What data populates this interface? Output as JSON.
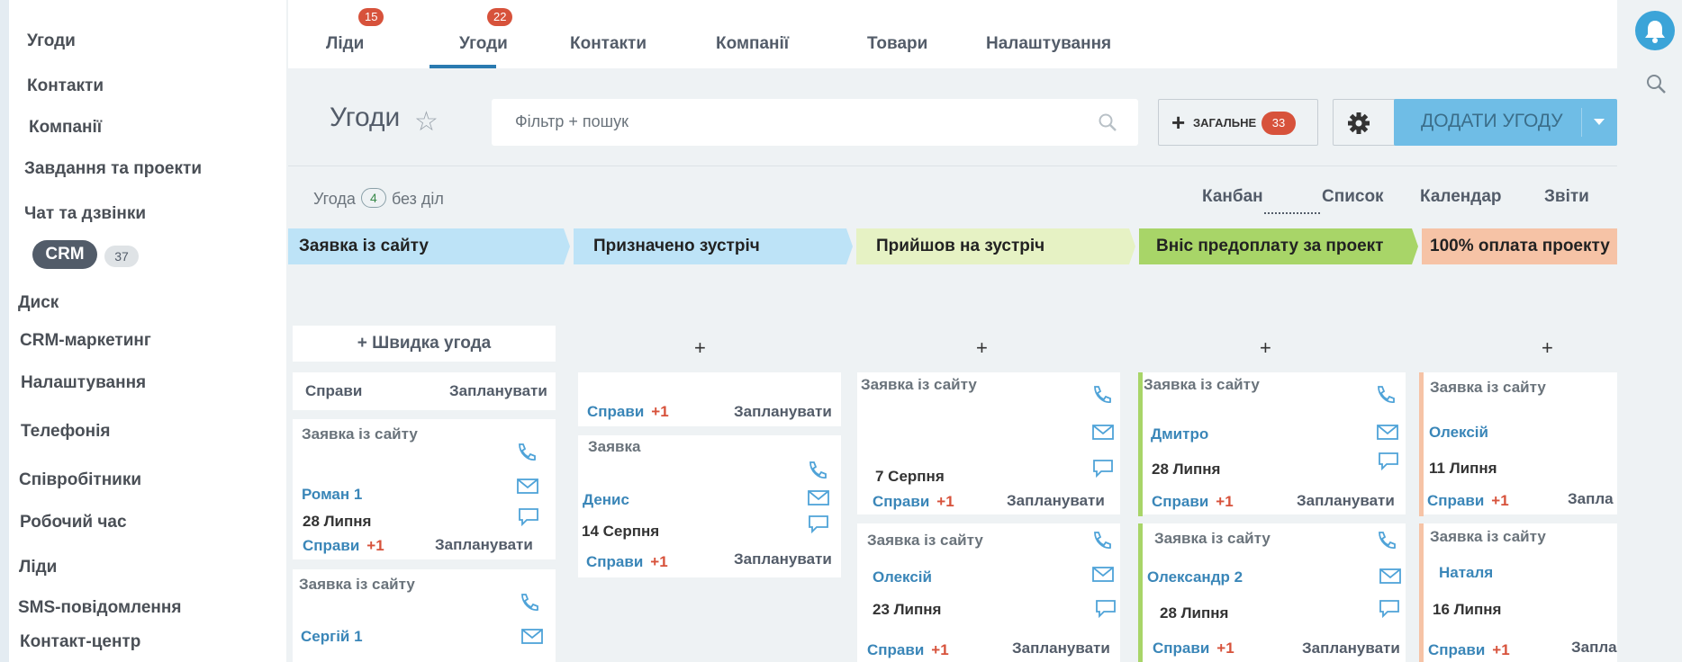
{
  "sidebar": {
    "items": [
      {
        "label": "Угоди"
      },
      {
        "label": "Контакти"
      },
      {
        "label": "Компанії"
      },
      {
        "label": "Завдання та проекти"
      },
      {
        "label": "Чат та дзвінки"
      },
      {
        "label": "Диск"
      },
      {
        "label": "CRM-маркетинг"
      },
      {
        "label": "Налаштування"
      },
      {
        "label": "Телефонія"
      },
      {
        "label": "Співробітники"
      },
      {
        "label": "Робочий час"
      },
      {
        "label": "Ліди"
      },
      {
        "label": "SMS-повідомлення"
      },
      {
        "label": "Контакт-центр"
      }
    ],
    "crm": {
      "label": "CRM",
      "count": "37"
    }
  },
  "tabs": [
    {
      "label": "Ліди",
      "badge": "15"
    },
    {
      "label": "Угоди",
      "badge": "22"
    },
    {
      "label": "Контакти"
    },
    {
      "label": "Компанії"
    },
    {
      "label": "Товари"
    },
    {
      "label": "Налаштування"
    }
  ],
  "header": {
    "title": "Угоди",
    "search_placeholder": "Фільтр + пошук",
    "general_label": "ЗАГАЛЬНЕ",
    "general_badge": "33",
    "add_label": "ДОДАТИ УГОДУ"
  },
  "summary": {
    "prefix": "Угода",
    "count": "4",
    "suffix": "без  діл"
  },
  "views": [
    "Канбан",
    "Список",
    "Календар",
    "Звіти"
  ],
  "quick_deal": "+ Швидка угода",
  "colors": {
    "accent": "#3a86b8",
    "badge": "#d7523b",
    "add_button": "#6fbde6"
  },
  "stages": [
    {
      "name": "Заявка із сайту",
      "color": "#bde3f7"
    },
    {
      "name": "Призначено зустріч",
      "color": "#bde3f7"
    },
    {
      "name": "Прийшов на  зустріч",
      "color": "#e6f2c4"
    },
    {
      "name": "Вніс предоплату за проект",
      "color": "#a8d568"
    },
    {
      "name": "100% оплата проекту",
      "color": "#f6c3a6"
    }
  ],
  "common": {
    "deals": "Справи",
    "plus": "+1",
    "plan": "Запланувати",
    "plus_add": "+"
  },
  "cards": [
    {
      "title": "Заявка із сайту",
      "name": "Роман 1",
      "date": "28 Липня"
    },
    {
      "title": "Заявка із сайту",
      "name": "Сергій 1"
    },
    {
      "title": "Заявка",
      "name": "Денис",
      "date": "14 Серпня"
    },
    {
      "title": "Заявка із сайту",
      "date": "7 Серпня"
    },
    {
      "title": "Заявка із сайту",
      "name": "Олексій",
      "date": "23 Липня"
    },
    {
      "title": "Заявка із сайту",
      "name": "Дмитро",
      "date": "28 Липня"
    },
    {
      "title": "Заявка із сайту",
      "name": "Олександр 2",
      "date": "28 Липня"
    },
    {
      "title": "Заявка із сайту",
      "name": "Олексій",
      "date": "11 Липня",
      "plan_partial": "Запла"
    },
    {
      "title": "Заявка із сайту",
      "name": "Наталя",
      "date": "16 Липня",
      "plan_partial": "Запла"
    }
  ]
}
